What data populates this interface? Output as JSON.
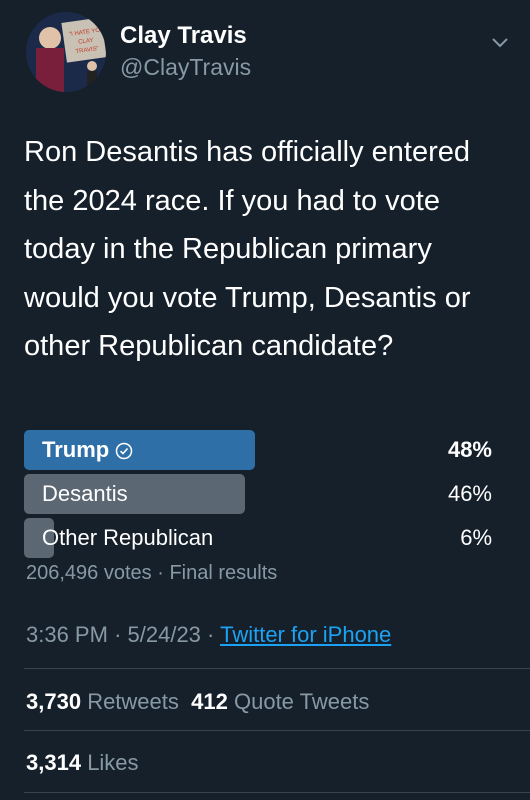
{
  "author": {
    "name": "Clay Travis",
    "handle": "@ClayTravis",
    "avatar_sign_text": "\"I HATE YOU CLAY TRAVIS\""
  },
  "tweet": {
    "text": "Ron Desantis has officially entered the 2024 race. If you had to vote today in the Republican primary would you vote Trump, Desantis or other Republican candidate?"
  },
  "poll": {
    "options": [
      {
        "label": "Trump",
        "percent_text": "48%",
        "percent": 48,
        "winner": true,
        "bar_color": "#2f6fa8"
      },
      {
        "label": "Desantis",
        "percent_text": "46%",
        "percent": 46,
        "winner": false,
        "bar_color": "#5b6873"
      },
      {
        "label": "Other Republican",
        "percent_text": "6%",
        "percent": 6,
        "winner": false,
        "bar_color": "#5b6873"
      }
    ],
    "votes": "206,496 votes",
    "separator": "·",
    "status": "Final results"
  },
  "meta": {
    "time": "3:36 PM",
    "sep1": "·",
    "date": "5/24/23",
    "sep2": "·",
    "source": "Twitter for iPhone"
  },
  "stats": {
    "retweets_count": "3,730",
    "retweets_label": "Retweets",
    "quotes_count": "412",
    "quotes_label": "Quote Tweets",
    "likes_count": "3,314",
    "likes_label": "Likes"
  },
  "icons": {
    "more": "chevron-down-icon",
    "winner": "check-circle-icon"
  },
  "colors": {
    "background": "#15202b",
    "muted": "#8899a6",
    "link": "#1da1f2",
    "divider": "#38444d"
  }
}
